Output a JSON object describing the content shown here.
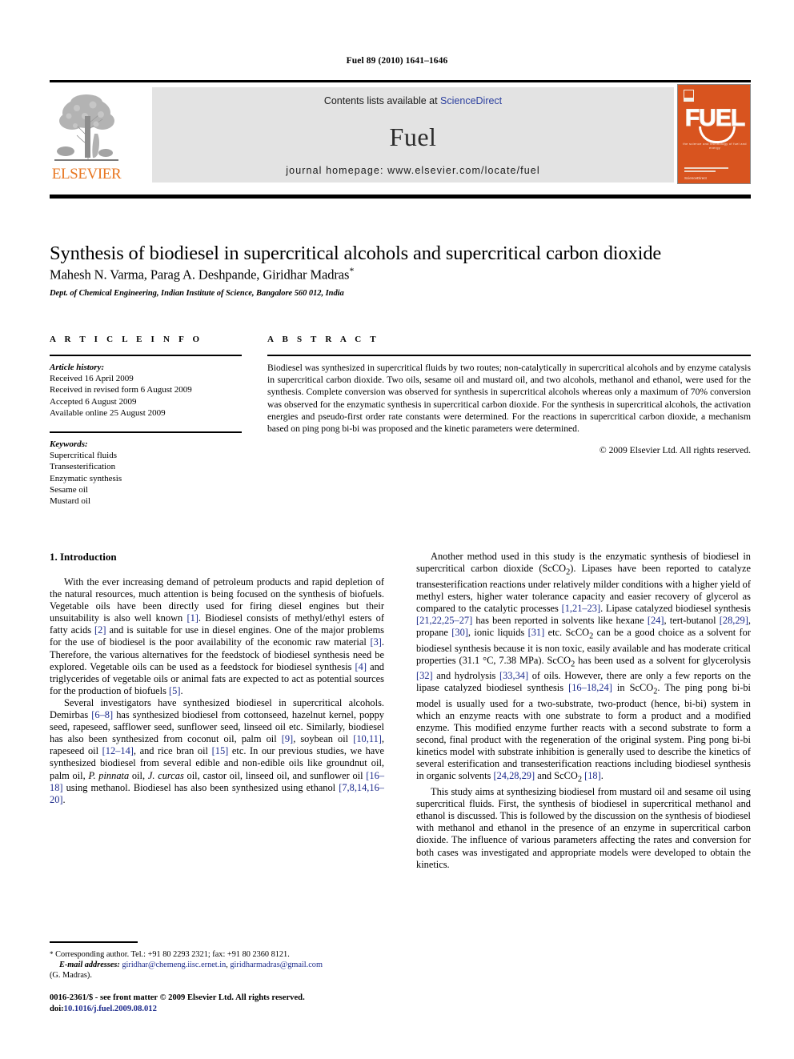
{
  "running_head": "Fuel 89 (2010) 1641–1646",
  "masthead": {
    "contents_prefix": "Contents lists available at ",
    "sciencedirect": "ScienceDirect",
    "journal_name": "Fuel",
    "journal_homepage": "journal homepage: www.elsevier.com/locate/fuel",
    "publisher_logo_text": "ELSEVIER",
    "publisher_logo_icon": "elsevier-tree-icon",
    "cover_title": "FUEL",
    "cover_tagline": "the science and technology of fuel and energy",
    "cover_publisher": "ScienceDirect",
    "band_color": "#e3e3e3",
    "cover_color": "#D8541F",
    "elsevier_orange": "#E87722",
    "link_blue": "#2b3f9e"
  },
  "article": {
    "title": "Synthesis of biodiesel in supercritical alcohols and supercritical carbon dioxide",
    "authors": "Mahesh N. Varma, Parag A. Deshpande, Giridhar Madras",
    "corresponding_marker": "*",
    "affiliation": "Dept. of Chemical Engineering, Indian Institute of Science, Bangalore 560 012, India"
  },
  "article_info": {
    "heading": "A R T I C L E   I N F O",
    "history_label": "Article history:",
    "history": [
      "Received 16 April 2009",
      "Received in revised form 6 August 2009",
      "Accepted 6 August 2009",
      "Available online 25 August 2009"
    ],
    "keywords_label": "Keywords:",
    "keywords": [
      "Supercritical fluids",
      "Transesterification",
      "Enzymatic synthesis",
      "Sesame oil",
      "Mustard oil"
    ]
  },
  "abstract": {
    "heading": "A B S T R A C T",
    "text": "Biodiesel was synthesized in supercritical fluids by two routes; non-catalytically in supercritical alcohols and by enzyme catalysis in supercritical carbon dioxide. Two oils, sesame oil and mustard oil, and two alcohols, methanol and ethanol, were used for the synthesis. Complete conversion was observed for synthesis in supercritical alcohols whereas only a maximum of 70% conversion was observed for the enzymatic synthesis in supercritical carbon dioxide. For the synthesis in supercritical alcohols, the activation energies and pseudo-first order rate constants were determined. For the reactions in supercritical carbon dioxide, a mechanism based on ping pong bi-bi was proposed and the kinetic parameters were determined.",
    "copyright": "© 2009 Elsevier Ltd. All rights reserved."
  },
  "body": {
    "section_heading": "1. Introduction",
    "left_paragraphs": [
      "With the ever increasing demand of petroleum products and rapid depletion of the natural resources, much attention is being focused on the synthesis of biofuels. Vegetable oils have been directly used for firing diesel engines but their unsuitability is also well known [1]. Biodiesel consists of methyl/ethyl esters of fatty acids [2] and is suitable for use in diesel engines. One of the major problems for the use of biodiesel is the poor availability of the economic raw material [3]. Therefore, the various alternatives for the feedstock of biodiesel synthesis need be explored. Vegetable oils can be used as a feedstock for biodiesel synthesis [4] and triglycerides of vegetable oils or animal fats are expected to act as potential sources for the production of biofuels [5].",
      "Several investigators have synthesized biodiesel in supercritical alcohols. Demirbas [6–8] has synthesized biodiesel from cottonseed, hazelnut kernel, poppy seed, rapeseed, safflower seed, sunflower seed, linseed oil etc. Similarly, biodiesel has also been synthesized from coconut oil, palm oil [9], soybean oil [10,11], rapeseed oil [12–14], and rice bran oil [15] etc. In our previous studies, we have synthesized biodiesel from several edible and non-edible oils like groundnut oil, palm oil, P. pinnata oil, J. curcas oil, castor oil, linseed oil, and sunflower oil [16–18] using methanol. Biodiesel has also been synthesized using ethanol [7,8,14,16–20]."
    ],
    "right_paragraphs": [
      "Another method used in this study is the enzymatic synthesis of biodiesel in supercritical carbon dioxide (ScCO2). Lipases have been reported to catalyze transesterification reactions under relatively milder conditions with a higher yield of methyl esters, higher water tolerance capacity and easier recovery of glycerol as compared to the catalytic processes [1,21–23]. Lipase catalyzed biodiesel synthesis [21,22,25–27] has been reported in solvents like hexane [24], tert-butanol [28,29], propane [30], ionic liquids [31] etc. ScCO2 can be a good choice as a solvent for biodiesel synthesis because it is non toxic, easily available and has moderate critical properties (31.1 °C, 7.38 MPa). ScCO2 has been used as a solvent for glycerolysis [32] and hydrolysis [33,34] of oils. However, there are only a few reports on the lipase catalyzed biodiesel synthesis [16–18,24] in ScCO2. The ping pong bi-bi model is usually used for a two-substrate, two-product (hence, bi-bi) system in which an enzyme reacts with one substrate to form a product and a modified enzyme. This modified enzyme further reacts with a second substrate to form a second, final product with the regeneration of the original system. Ping pong bi-bi kinetics model with substrate inhibition is generally used to describe the kinetics of several esterification and transesterification reactions including biodiesel synthesis in organic solvents [24,28,29] and ScCO2 [18].",
      "This study aims at synthesizing biodiesel from mustard oil and sesame oil using supercritical fluids. First, the synthesis of biodiesel in supercritical methanol and ethanol is discussed. This is followed by the discussion on the synthesis of biodiesel with methanol and ethanol in the presence of an enzyme in supercritical carbon dioxide. The influence of various parameters affecting the rates and conversion for both cases was investigated and appropriate models were developed to obtain the kinetics."
    ]
  },
  "footnote": {
    "corresponding": "Corresponding author. Tel.: +91 80 2293 2321; fax: +91 80 2360 8121.",
    "email_label": "E-mail addresses:",
    "email1": "giridhar@chemeng.iisc.ernet.in",
    "email2": "giridharmadras@gmail.com",
    "email_attrib": "(G. Madras)."
  },
  "imprint": {
    "issn_line": "0016-2361/$ - see front matter © 2009 Elsevier Ltd. All rights reserved.",
    "doi_label": "doi:",
    "doi": "10.1016/j.fuel.2009.08.012"
  }
}
